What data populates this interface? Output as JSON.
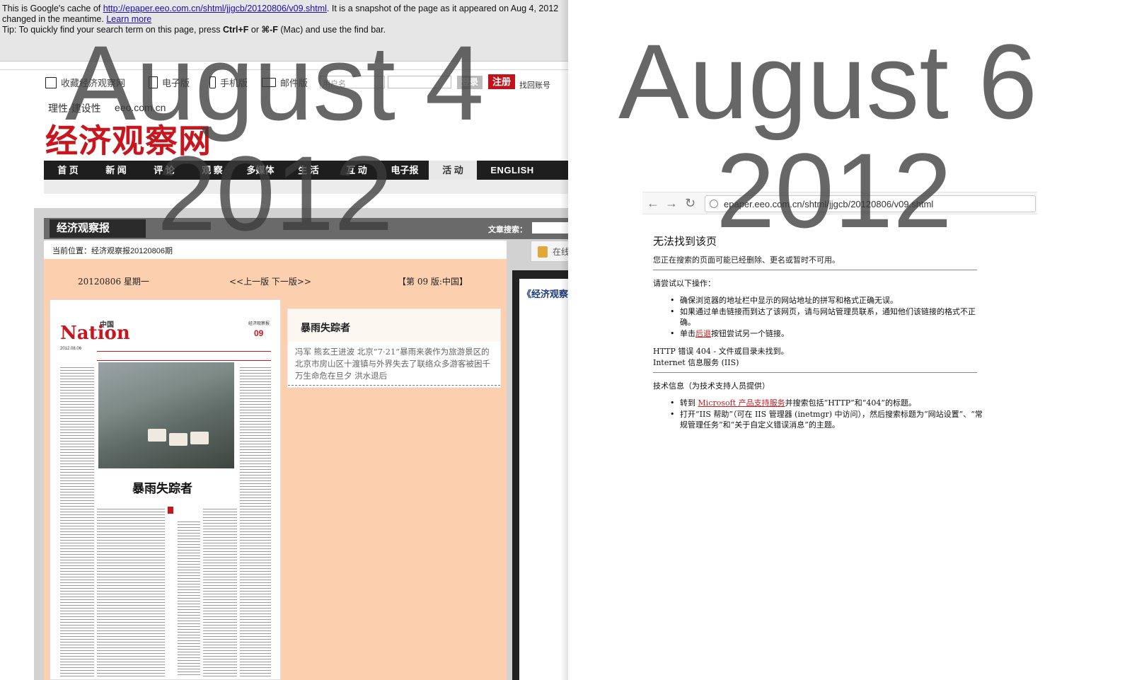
{
  "overlay": {
    "left_month": "August 4",
    "left_year": "2012",
    "right_month": "August 6",
    "right_year": "2012"
  },
  "cache_banner": {
    "line1_prefix": "This is Google's cache of ",
    "url": "http://epaper.eeo.com.cn/shtml/jjgcb/20120806/v09.shtml",
    "line1_suffix": ". It is a snapshot of the page as it appeared on Aug 4, 2012",
    "line2_prefix": "changed in the meantime. ",
    "learn_more": "Learn more",
    "tip_prefix": "Tip: To quickly find your search term on this page, press ",
    "tip_key1": "Ctrl+F",
    "tip_mid": " or ",
    "tip_key2": "⌘-F",
    "tip_suffix": " (Mac) and use the find bar."
  },
  "topbar": {
    "bookmark": "收藏经济观察网",
    "epaper": "电子版",
    "mobile": "手机版",
    "mail": "邮件版",
    "username_placeholder": "用户名",
    "login": "登录",
    "register": "注册",
    "find_account": "找回账号"
  },
  "brand": {
    "slogan": "理性·建设性",
    "domain": "eeo.com.cn",
    "logo": "经济观察网"
  },
  "nav": {
    "items": [
      "首 页",
      "新 闻",
      "评 论",
      "观 察",
      "多媒体",
      "生 活",
      "互 动",
      "电子报",
      "活 动",
      "ENGLISH"
    ]
  },
  "epaper": {
    "tag": "经济观察报",
    "search_label": "文章搜索：",
    "breadcrumb": "当前位置：经济观察报20120806期",
    "online": "在线",
    "date": "20120806 星期一",
    "prev_next": "<<上一版  下一版>>",
    "page": "【第 09 版:中国】",
    "right_tag": "《经济观察"
  },
  "newspaper": {
    "cn": "中国",
    "title": "Nation",
    "date": "2012.08.06",
    "brand": "经济观察报",
    "num": "09",
    "headline": "暴雨失踪者"
  },
  "article": {
    "title": "暴雨失踪者",
    "body": "冯军 熊玄王进波  北京“7·21”暴雨来袭作为旅游景区的北京市房山区十渡镇与外界失去了联络众多游客被困千万生命危在旦夕  洪水退后"
  },
  "right_browser": {
    "url": "epaper.eeo.com.cn/shtml/jjgcb/20120806/v09.shtml"
  },
  "error_page": {
    "title": "无法找到该页",
    "subtitle": "您正在搜索的页面可能已经删除、更名或暂时不可用。",
    "try_heading": "请尝试以下操作：",
    "try_items": [
      "确保浏览器的地址栏中显示的网站地址的拼写和格式正确无误。",
      "如果通过单击链接而到达了该网页，请与网站管理员联系，通知他们该链接的格式不正确。"
    ],
    "back_prefix": "单击",
    "back_link": "后退",
    "back_suffix": "按钮尝试另一个链接。",
    "http_error": "HTTP 错误 404 - 文件或目录未找到。",
    "iis": "Internet 信息服务 (IIS)",
    "tech_heading": "技术信息（为技术支持人员提供）",
    "tech_item1_prefix": "转到 ",
    "tech_item1_link": "Microsoft 产品支持服务",
    "tech_item1_suffix": "并搜索包括“HTTP”和“404”的标题。",
    "tech_item2": "打开“IIS 帮助”（可在 IIS 管理器 (inetmgr) 中访问），然后搜索标题为“网站设置”、“常规管理任务”和“关于自定义错误消息”的主题。"
  },
  "colors": {
    "brand_red": "#c8161e",
    "peach": "#fcd0ae",
    "link_blue": "#1a0dab"
  }
}
